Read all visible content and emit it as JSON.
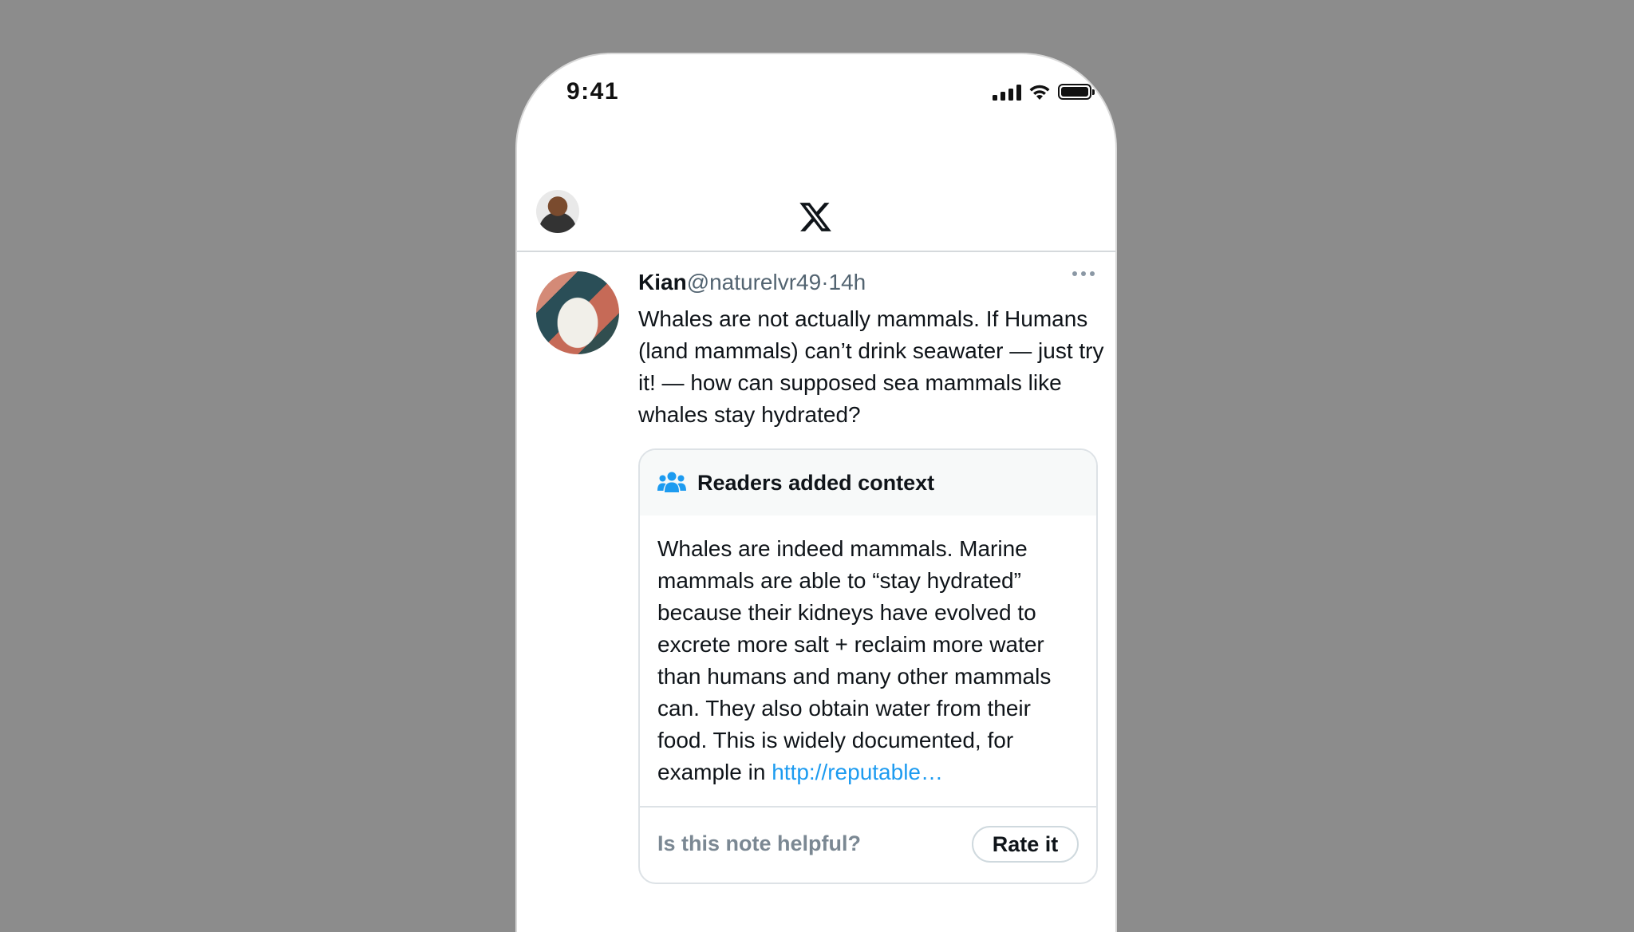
{
  "status_bar": {
    "time": "9:41"
  },
  "tweet": {
    "author": "Kian",
    "handle": "@naturelvr49",
    "separator": "·",
    "age": "14h",
    "text": "Whales are not actually mammals. If Humans (land mammals) can’t drink seawater — just try it! — how can supposed sea mammals like whales stay hydrated?"
  },
  "community_note": {
    "header": "Readers added context",
    "text": "Whales are indeed mammals. Marine mammals are able to “stay hydrated” because their kidneys have evolved to excrete more salt + reclaim more water than humans and many other mammals can. They also obtain water from their food. This is widely documented, for example in ",
    "link_text": "http://reputable…",
    "question": "Is this note helpful?",
    "rate_label": "Rate it"
  },
  "colors": {
    "link": "#1d9bf0",
    "background": "#8c8c8c"
  },
  "icons": [
    "signal-icon",
    "wifi-icon",
    "battery-icon",
    "x-logo-icon",
    "more-icon",
    "people-icon"
  ]
}
